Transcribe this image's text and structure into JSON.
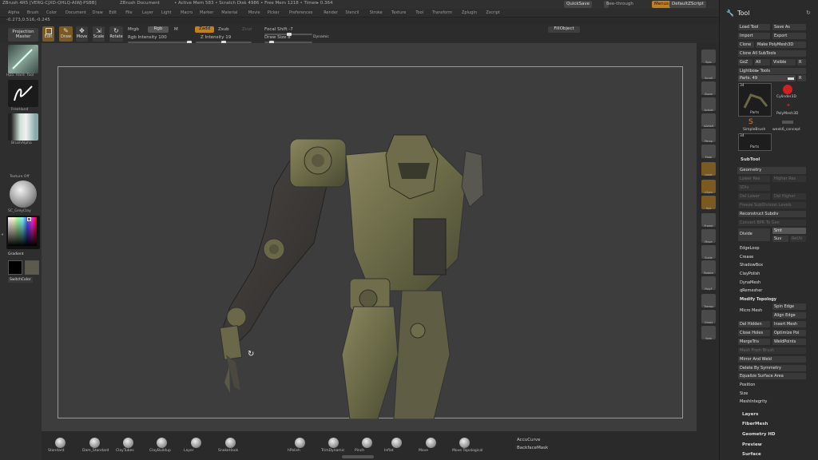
{
  "titlebar": {
    "app": "ZBrush 4R5 [VERG-CJXD-QHLQ-AIWJ-PSBB]",
    "doc": "ZBrush Document",
    "mem": "• Active Mem 583 • Scratch Disk 4986 • Free Mem 1218 • Timer▸ 0.364",
    "quicksave": "QuickSave",
    "seethrough": "See-through",
    "seethrough_value": "0",
    "menus_btn": "Menus",
    "script": "DefaultZScript"
  },
  "menubar": [
    "Alpha",
    "Brush",
    "Color",
    "Document",
    "Draw",
    "Edit",
    "File",
    "Layer",
    "Light",
    "Macro",
    "Marker",
    "Material",
    "Movie",
    "Picker",
    "Preferences",
    "Render",
    "Stencil",
    "Stroke",
    "Texture",
    "Tool",
    "Transform",
    "Zplugin",
    "Zscript"
  ],
  "coords": "-0.273,0.516,-0.245",
  "shelf": {
    "projection_master": "Projection Master",
    "edit": "Edit",
    "draw": "Draw",
    "move": "Move",
    "scale": "Scale",
    "rotate": "Rotate",
    "mrgb": "Mrgb",
    "rgb": "Rgb",
    "m": "M",
    "rgb_intensity": "Rgb Intensity 100",
    "zadd": "Zadd",
    "zsub": "Zsub",
    "zcut": "Zcut",
    "z_intensity": "Z Intensity 19",
    "focal_shift": "Focal Shift -7",
    "draw_size": "Draw Size 8",
    "dynamic": "Dynamic",
    "fillobject": "FillObject"
  },
  "lefttray": {
    "brush": "Hpo. Hard. Tool",
    "stroke": "FreeHand",
    "alpha": "BrushAlpha",
    "texture": "Texture Off",
    "material": "SC_GreyClay",
    "gradient": "Gradient",
    "switchcolor": "SwitchColor"
  },
  "righttools": [
    "Spix",
    "Scroll",
    "Zoom",
    "Actual",
    "AAHalf",
    "Persp",
    "Floor",
    "Local",
    "LSym",
    "Xyz",
    "Frame",
    "Move",
    "Scale",
    "Rotate",
    "PolyF",
    "Transp",
    "Ghost",
    "Solo"
  ],
  "bottom": {
    "brushes": [
      "Standard",
      "Dam_Standard",
      "ClayTubes",
      "ClayBuildup",
      "Layer",
      "SnakeHook",
      "hPolish",
      "TrimDynamic",
      "Pinch",
      "Inflat",
      "Move",
      "Move Topological"
    ],
    "accucurve": "AccuCurve",
    "backfacemask": "BackfaceMask"
  },
  "panel": {
    "title": "Tool",
    "load": "Load Tool",
    "save": "Save As",
    "import": "Import",
    "export": "Export",
    "clone": "Clone",
    "make_polymesh": "Make PolyMesh3D",
    "clone_all": "Clone All SubTools",
    "goz": "GoZ",
    "all": "All",
    "visible": "Visible",
    "r": "R",
    "lightbox": "Lightbox▸ Tools",
    "parts": "Parts. 49",
    "thumbs": [
      "Parts",
      "Cylinder3D",
      "PolyMesh3D",
      "SimpleBrush",
      "week6_concept",
      "Parts"
    ],
    "thumb_num1": "34",
    "thumb_num2": "34",
    "subtool": "SubTool",
    "geometry": "Geometry",
    "lower_res": "Lower Res",
    "higher_res": "Higher Res",
    "sdiv": "SDiv",
    "del_lower": "Del Lower",
    "del_higher": "Del Higher",
    "freeze": "Freeze SubDivision Levels",
    "reconstruct": "Reconstruct Subdiv",
    "convert_bpr": "Convert BPR To Geo",
    "divide": "Divide",
    "smt": "Smt",
    "suv": "Suv",
    "rsuv": "ReUV",
    "items": [
      "EdgeLoop",
      "Crease",
      "ShadowBox",
      "ClayPolish",
      "DynaMesh",
      "qRemesher"
    ],
    "modify": "Modify Topology",
    "micro": "Micro Mesh",
    "spin_edge": "Spin Edge",
    "align_edge": "Align Edge",
    "del_hidden": "Del Hidden",
    "insert_mesh": "Insert Mesh",
    "close_holes": "Close Holes",
    "optimize": "Optimize Poi",
    "mergetris": "MergeTris",
    "weldpoints": "WeldPoints",
    "mesh_from_brush": "Mesh From Brush",
    "mirror_weld": "Mirror And Weld",
    "delete_symmetry": "Delete By Symmetry",
    "equalize": "Equalize Surface Area",
    "position": "Position",
    "size": "Size",
    "meshintegrity": "MeshIntegrity",
    "layers": "Layers",
    "fibermesh": "FiberMesh",
    "geometry_hd": "Geometry HD",
    "preview": "Preview",
    "surface": "Surface"
  }
}
